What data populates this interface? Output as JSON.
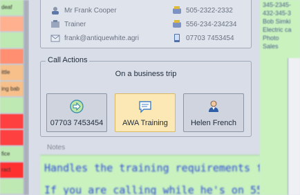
{
  "left_list": {
    "rows": [
      {
        "text": "deaf",
        "color": "#bfe9b3"
      },
      {
        "text": "",
        "color": "#ffb08f"
      },
      {
        "text": "",
        "color": "#bfe9b3"
      },
      {
        "text": "",
        "color": "#ff8f70"
      },
      {
        "text": "ittle",
        "color": "#f7c08a"
      },
      {
        "text": "ing bab",
        "color": "#f7c08a"
      },
      {
        "text": "",
        "color": "#bfe9b3"
      },
      {
        "text": "",
        "color": "#ff4040"
      },
      {
        "text": "",
        "color": "#ff4040"
      },
      {
        "text": "fice",
        "color": "#bfe9b3"
      },
      {
        "text": "ract",
        "color": "#ff3030"
      },
      {
        "text": "",
        "color": "#bfe9b3"
      }
    ]
  },
  "contact": {
    "name": "Mr Frank Cooper",
    "title": "Trainer",
    "email": "frank@antiquewhite.agri",
    "phone1": "505-2322-2332",
    "phone2": "556-234-234234",
    "mobile": "07703 7453454"
  },
  "call_actions": {
    "legend": "Call Actions",
    "status": "On a business trip",
    "buttons": [
      {
        "label": "07703 7453454",
        "icon": "call-forward-icon"
      },
      {
        "label": "AWA Training",
        "icon": "message-icon"
      },
      {
        "label": "Helen French",
        "icon": "person-icon"
      }
    ]
  },
  "notes": {
    "label": "Notes",
    "line1": "Handles the training requirements for",
    "line2": "If you are calling while he's on 55"
  },
  "right_strip": {
    "lines": [
      "345-2345-",
      "432-345-3",
      "Bob Simki",
      "Electric ca",
      "Photo",
      "Sales"
    ]
  }
}
